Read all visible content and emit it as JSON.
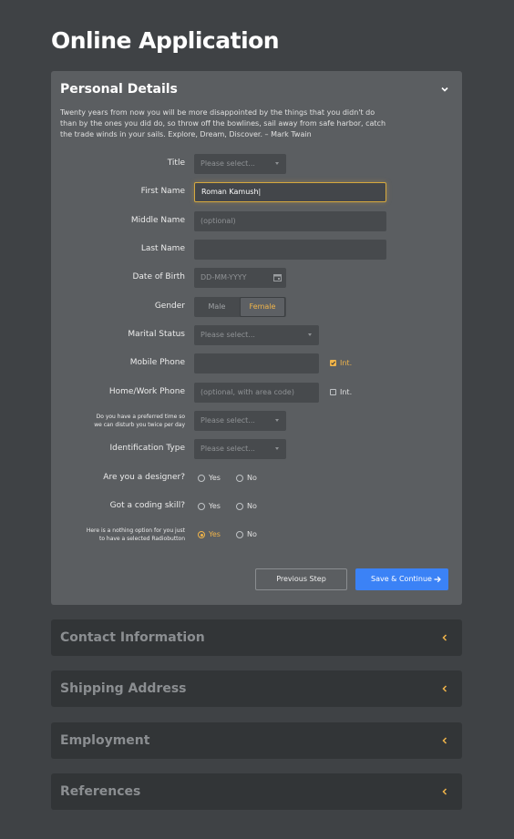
{
  "page_title": "Online Application",
  "colors": {
    "accent": "#f0b44a",
    "primary": "#3b82f6",
    "panel": "#5b5e61",
    "background": "#3f4245"
  },
  "personal": {
    "title": "Personal Details",
    "quote": "Twenty years from now you will be more disappointed by the things that you didn't do than by the ones you did do, so throw off the bowlines, sail away from safe harbor, catch the trade winds in your sails. Explore, Dream, Discover. – Mark Twain",
    "fields": {
      "title": {
        "label": "Title",
        "placeholder": "Please select..."
      },
      "first_name": {
        "label": "First Name",
        "value": "Roman Kamush|"
      },
      "middle_name": {
        "label": "Middle Name",
        "placeholder": "(optional)"
      },
      "last_name": {
        "label": "Last Name",
        "value": ""
      },
      "dob": {
        "label": "Date of Birth",
        "placeholder": "DD-MM-YYYY"
      },
      "gender": {
        "label": "Gender",
        "options": [
          "Male",
          "Female"
        ],
        "selected": "Female"
      },
      "marital": {
        "label": "Marital Status",
        "placeholder": "Please select..."
      },
      "mobile": {
        "label": "Mobile Phone",
        "value": "",
        "intl_label": "Int.",
        "intl_checked": true
      },
      "home_work": {
        "label": "Home/Work Phone",
        "placeholder": "(optional, with area code)",
        "intl_label": "Int.",
        "intl_checked": false
      },
      "preferred_time": {
        "label_line1": "Do you have a preferred time so",
        "label_line2": "we can disturb you twice per day",
        "placeholder": "Please select..."
      },
      "identification": {
        "label": "Identification Type",
        "placeholder": "Please select..."
      },
      "designer": {
        "label": "Are you a designer?",
        "yes": "Yes",
        "no": "No",
        "selected": ""
      },
      "coding": {
        "label": "Got a coding skill?",
        "yes": "Yes",
        "no": "No",
        "selected": ""
      },
      "nothing": {
        "label_line1": "Here is a nothing option for you just",
        "label_line2": "to have a selected Radiobutton",
        "yes": "Yes",
        "no": "No",
        "selected": "Yes"
      }
    },
    "buttons": {
      "previous": "Previous Step",
      "next": "Save & Continue"
    }
  },
  "sections": [
    {
      "title": "Contact Information"
    },
    {
      "title": "Shipping Address"
    },
    {
      "title": "Employment"
    },
    {
      "title": "References"
    }
  ],
  "icons": {
    "collapse": "chevron-down-icon",
    "expand": "chevron-left-icon",
    "calendar": "calendar-icon",
    "next": "arrow-right-icon"
  }
}
